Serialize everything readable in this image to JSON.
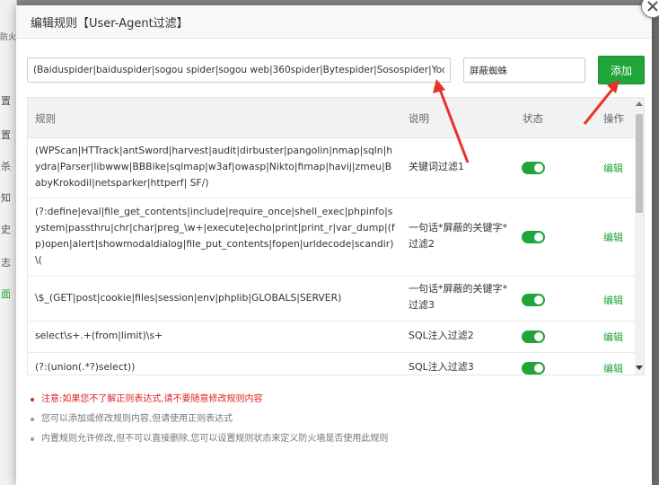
{
  "background": {
    "top_text": "防火",
    "side_texts": [
      "置",
      "置",
      "杀",
      "知",
      "史",
      "志",
      "面"
    ]
  },
  "dialog": {
    "title": "编辑规则【User-Agent过滤】"
  },
  "form": {
    "rule_value": "(Baiduspider|baiduspider|sogou spider|sogou web|360spider|Bytespider|Sosospider|Yodaoi",
    "desc_value": "屏蔽蜘蛛",
    "add_label": "添加"
  },
  "table": {
    "headers": {
      "rule": "规则",
      "desc": "说明",
      "status": "状态",
      "action": "操作"
    },
    "rows": [
      {
        "rule": "(WPScan|HTTrack|antSword|harvest|audit|dirbuster|pangolin|nmap|sqln|hydra|Parser|libwww|BBBike|sqlmap|w3af|owasp|Nikto|fimap|havij|zmeu|BabyKrokodil|netsparker|httperf| SF/)",
        "desc": "关键词过滤1",
        "enabled": true,
        "edit": "编辑"
      },
      {
        "rule": "(?:define|eval|file_get_contents|include|require_once|shell_exec|phpinfo|system|passthru|chr|char|preg_\\w+|execute|echo|print|print_r|var_dump|(fp)open|alert|showmodaldialog|file_put_contents|fopen|urldecode|scandir)\\(",
        "desc": "一句话*屏蔽的关键字*过滤2",
        "enabled": true,
        "edit": "编辑"
      },
      {
        "rule": "\\$_(GET|post|cookie|files|session|env|phplib|GLOBALS|SERVER)",
        "desc": "一句话*屏蔽的关键字*过滤3",
        "enabled": true,
        "edit": "编辑"
      },
      {
        "rule": "select\\s+.+(from|limit)\\s+",
        "desc": "SQL注入过滤2",
        "enabled": true,
        "edit": "编辑"
      },
      {
        "rule": "(?:(union(.*?)select))",
        "desc": "SQL注入过滤3",
        "enabled": true,
        "edit": "编辑"
      }
    ]
  },
  "notes": {
    "warning": "注意:如果您不了解正则表达式,请不要随意修改规则内容",
    "info1": "您可以添加或修改规则内容,但请使用正则表达式",
    "info2": "内置规则允许修改,但不可以直接删除,您可以设置规则状态来定义防火墙是否使用此规则"
  },
  "colors": {
    "accent": "#20a53a",
    "warning": "#e02020",
    "annotation_arrow": "#e8322a"
  },
  "icons": {
    "close": "close-icon",
    "scroll_up": "arrow-up-icon",
    "scroll_down": "arrow-down-icon"
  }
}
